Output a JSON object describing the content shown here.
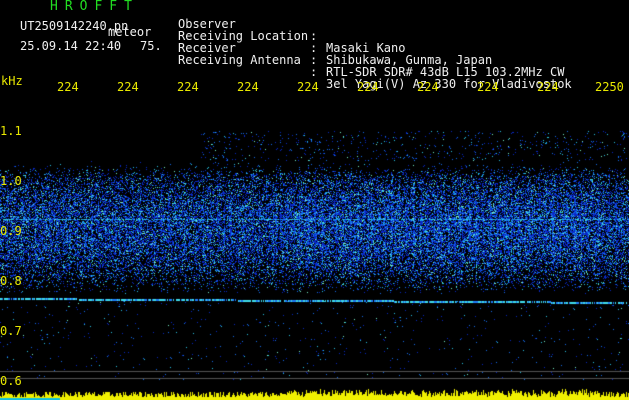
{
  "header": {
    "title": "HROFFT",
    "filename": "UT2509142240.pn",
    "meteor_label": "meteor",
    "datetime": "25.09.14 22:40",
    "count": "75.",
    "rows": [
      {
        "label": "Observer",
        "value": "Masaki Kano"
      },
      {
        "label": "Receiving Location",
        "value": "Shibukawa, Gunma, Japan"
      },
      {
        "label": "Receiver",
        "value": "RTL-SDR SDR# 43dB L15 103.2MHz CW"
      },
      {
        "label": "Receiving Antenna",
        "value": "3el Yagi(V) Az 330 for Vladivostok"
      }
    ]
  },
  "axis": {
    "unit": "kHz",
    "x_ticks": [
      "224",
      "224",
      "224",
      "224",
      "224",
      "224",
      "224",
      "224",
      "224",
      "2250"
    ],
    "y_ticks": [
      "1.1",
      "1.0",
      "0.9",
      "0.8",
      "0.7",
      "0.6"
    ]
  },
  "colors": {
    "label_yellow": "#e8e800",
    "title_green": "#22dd22",
    "text_white": "#f0f0f0"
  }
}
